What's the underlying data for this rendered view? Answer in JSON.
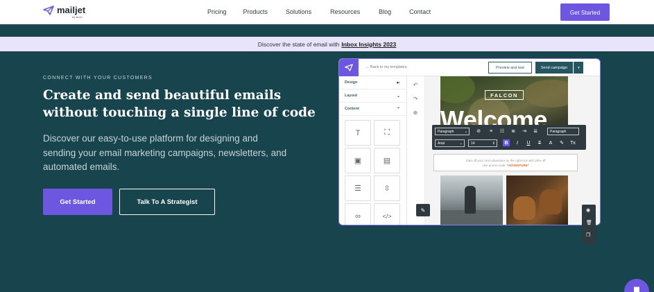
{
  "nav": {
    "logo_text": "mailjet",
    "logo_sub": "by sinch",
    "links": [
      "Pricing",
      "Products",
      "Solutions",
      "Resources",
      "Blog",
      "Contact"
    ],
    "cta": "Get Started"
  },
  "banner": {
    "text": "Discover the state of email with",
    "link": "Inbox Insights 2023"
  },
  "hero": {
    "eyebrow": "CONNECT WITH YOUR CUSTOMERS",
    "headline": "Create and send beautiful emails without touching a single line of code",
    "subtext": "Discover our easy-to-use platform for designing and sending your email marketing campaigns, newsletters, and automated emails.",
    "primary_cta": "Get Started",
    "secondary_cta": "Talk To A Strategist"
  },
  "editor": {
    "back_link": "Back to my templates",
    "preview_button": "Preview and test",
    "send_button": "Send campaign",
    "side_sections": [
      {
        "label": "Design",
        "icon": "⇤"
      },
      {
        "label": "Layout",
        "icon": "⌄"
      },
      {
        "label": "Content",
        "icon": "⌃"
      }
    ],
    "email": {
      "brand": "FALCON",
      "hero_title": "Welcome",
      "body_line1": "Start off your next adventure on the right foot with 20% off",
      "body_line2_prefix": "Use promo code:",
      "promo_code": "*ADVENTURE*"
    },
    "format_bar": {
      "paragraph_select": "Paragraph",
      "paragraph_select_right": "Paragraph",
      "font_select": "Arial",
      "size_select": "14"
    }
  },
  "colors": {
    "brand_purple": "#6e57e0",
    "hero_bg": "#18444e",
    "banner_bg": "#e9e4fb"
  }
}
